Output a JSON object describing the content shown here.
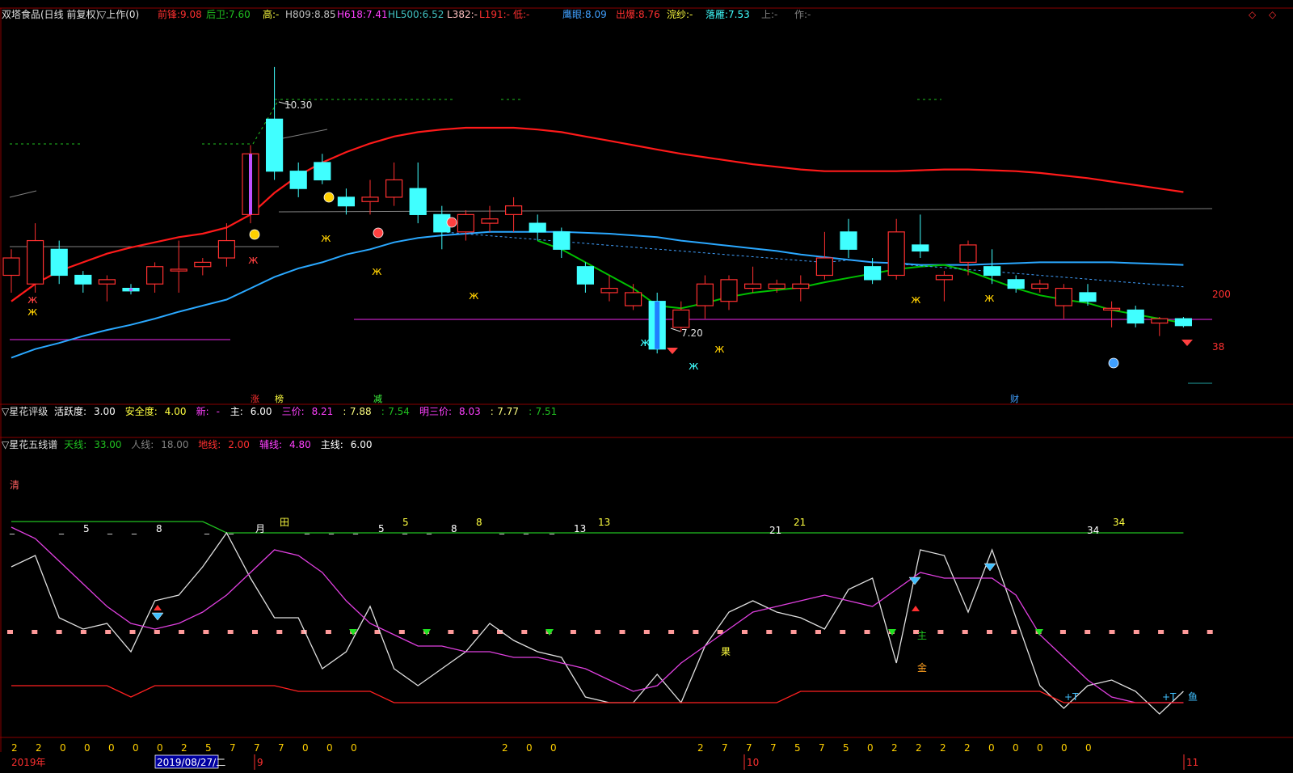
{
  "security": {
    "name": "双塔食品(日线 前复权)",
    "indicator": "▽上作(0)"
  },
  "header": {
    "indicators": [
      {
        "label": "前锋:",
        "value": "9.08",
        "color": "#ff3030"
      },
      {
        "label": "后卫:",
        "value": "7.60",
        "color": "#20c020"
      },
      {
        "label": "高:",
        "value": "-",
        "color": "#ffff40"
      },
      {
        "label": "H809:",
        "value": "8.85",
        "color": "#c0c0c0"
      },
      {
        "label": "H618:",
        "value": "7.41",
        "color": "#ff40ff"
      },
      {
        "label": "HL500:",
        "value": "6.52",
        "color": "#40c0c0"
      },
      {
        "label": "L382:",
        "value": "-",
        "color": "#ffc0c0"
      },
      {
        "label": "L191:",
        "value": "-",
        "color": "#ff3030"
      },
      {
        "label": "低:",
        "value": "-",
        "color": "#ff3030"
      },
      {
        "label": "鹰眼:",
        "value": "8.09",
        "color": "#40a0ff"
      },
      {
        "label": "出爆:",
        "value": "8.76",
        "color": "#ff3030"
      },
      {
        "label": "浣纱:",
        "value": "-",
        "color": "#ffff40"
      },
      {
        "label": "落雁:",
        "value": "7.53",
        "color": "#40ffff"
      },
      {
        "label": "上:",
        "value": "-",
        "color": "#808080"
      },
      {
        "label": "作:",
        "value": "-",
        "color": "#808080"
      }
    ]
  },
  "panel2": {
    "title": "▽星花评级",
    "items": [
      {
        "label": "活跃度:",
        "value": "3.00",
        "color": "#ffffff"
      },
      {
        "label": "安全度:",
        "value": "4.00",
        "color": "#ffff40"
      },
      {
        "label": "新:",
        "value": "-",
        "color": "#ff40ff"
      },
      {
        "label": "主:",
        "value": "6.00",
        "color": "#ffffff"
      },
      {
        "label": "三价:",
        "value": "8.21",
        "color": "#ff40ff"
      },
      {
        "label": ":",
        "value": "7.88",
        "color": "#ffff80"
      },
      {
        "label": ":",
        "value": "7.54",
        "color": "#20c020"
      },
      {
        "label": "明三价:",
        "value": "8.03",
        "color": "#ff40ff"
      },
      {
        "label": ":",
        "value": "7.77",
        "color": "#ffff80"
      },
      {
        "label": ":",
        "value": "7.51",
        "color": "#20c020"
      }
    ]
  },
  "panel3": {
    "title": "▽星花五线谱",
    "items": [
      {
        "label": "天线:",
        "value": "33.00",
        "color": "#20c020"
      },
      {
        "label": "人线:",
        "value": "18.00",
        "color": "#808080"
      },
      {
        "label": "地线:",
        "value": "2.00",
        "color": "#ff3030"
      },
      {
        "label": "辅线:",
        "value": "4.80",
        "color": "#ff40ff"
      },
      {
        "label": "主线:",
        "value": "6.00",
        "color": "#ffffff"
      }
    ]
  },
  "xaxis": {
    "year": "2019年",
    "cursor_date": "2019/08/27/二",
    "month_labels": [
      "9",
      "10",
      "11"
    ]
  },
  "chart_data": [
    {
      "type": "candlestick",
      "title": "双塔食品(日线 前复权)",
      "annotations": {
        "high": "10.30",
        "low": "7.20",
        "right_top": "200",
        "right_mid": "38"
      },
      "bottom_marks": [
        {
          "text": "涨",
          "color": "#ff3030"
        },
        {
          "text": "榜",
          "color": "#ffff40"
        },
        {
          "text": "减",
          "color": "#40ff40"
        },
        {
          "text": "财",
          "color": "#40a0ff"
        }
      ],
      "ylim": [
        6.6,
        10.7
      ],
      "candles": [
        {
          "o": 7.9,
          "c": 8.1,
          "h": 8.2,
          "l": 7.7
        },
        {
          "o": 7.8,
          "c": 8.3,
          "h": 8.5,
          "l": 7.7
        },
        {
          "o": 8.2,
          "c": 7.9,
          "h": 8.3,
          "l": 7.8
        },
        {
          "o": 7.9,
          "c": 7.8,
          "h": 7.95,
          "l": 7.7
        },
        {
          "o": 7.8,
          "c": 7.85,
          "h": 7.9,
          "l": 7.6
        },
        {
          "o": 7.75,
          "c": 7.72,
          "h": 7.8,
          "l": 7.68
        },
        {
          "o": 7.8,
          "c": 8.0,
          "h": 8.05,
          "l": 7.7
        },
        {
          "o": 7.95,
          "c": 7.97,
          "h": 8.3,
          "l": 7.7
        },
        {
          "o": 8.0,
          "c": 8.05,
          "h": 8.1,
          "l": 7.9
        },
        {
          "o": 8.1,
          "c": 8.3,
          "h": 8.5,
          "l": 8.0
        },
        {
          "o": 8.6,
          "c": 9.3,
          "h": 9.4,
          "l": 8.5
        },
        {
          "o": 9.7,
          "c": 9.1,
          "h": 10.3,
          "l": 9.0
        },
        {
          "o": 9.1,
          "c": 8.9,
          "h": 9.2,
          "l": 8.8
        },
        {
          "o": 9.2,
          "c": 9.0,
          "h": 9.3,
          "l": 8.95
        },
        {
          "o": 8.8,
          "c": 8.7,
          "h": 8.9,
          "l": 8.6
        },
        {
          "o": 8.75,
          "c": 8.8,
          "h": 9.0,
          "l": 8.6
        },
        {
          "o": 8.8,
          "c": 9.0,
          "h": 9.2,
          "l": 8.7
        },
        {
          "o": 8.9,
          "c": 8.6,
          "h": 9.2,
          "l": 8.5
        },
        {
          "o": 8.6,
          "c": 8.4,
          "h": 8.7,
          "l": 8.2
        },
        {
          "o": 8.4,
          "c": 8.6,
          "h": 8.65,
          "l": 8.3
        },
        {
          "o": 8.5,
          "c": 8.55,
          "h": 8.7,
          "l": 8.4
        },
        {
          "o": 8.6,
          "c": 8.7,
          "h": 8.8,
          "l": 8.4
        },
        {
          "o": 8.5,
          "c": 8.4,
          "h": 8.6,
          "l": 8.3
        },
        {
          "o": 8.4,
          "c": 8.2,
          "h": 8.45,
          "l": 8.1
        },
        {
          "o": 8.0,
          "c": 7.8,
          "h": 8.05,
          "l": 7.7
        },
        {
          "o": 7.7,
          "c": 7.75,
          "h": 7.9,
          "l": 7.6
        },
        {
          "o": 7.55,
          "c": 7.7,
          "h": 7.8,
          "l": 7.5
        },
        {
          "o": 7.6,
          "c": 7.05,
          "h": 7.7,
          "l": 7.0
        },
        {
          "o": 7.3,
          "c": 7.5,
          "h": 7.6,
          "l": 7.25
        },
        {
          "o": 7.55,
          "c": 7.8,
          "h": 7.9,
          "l": 7.4
        },
        {
          "o": 7.6,
          "c": 7.85,
          "h": 7.9,
          "l": 7.5
        },
        {
          "o": 7.75,
          "c": 7.8,
          "h": 8.0,
          "l": 7.7
        },
        {
          "o": 7.75,
          "c": 7.8,
          "h": 7.85,
          "l": 7.7
        },
        {
          "o": 7.75,
          "c": 7.8,
          "h": 7.9,
          "l": 7.6
        },
        {
          "o": 7.9,
          "c": 8.1,
          "h": 8.4,
          "l": 7.85
        },
        {
          "o": 8.4,
          "c": 8.2,
          "h": 8.55,
          "l": 8.1
        },
        {
          "o": 8.0,
          "c": 7.85,
          "h": 8.1,
          "l": 7.8
        },
        {
          "o": 7.9,
          "c": 8.4,
          "h": 8.55,
          "l": 7.85
        },
        {
          "o": 8.25,
          "c": 8.18,
          "h": 8.6,
          "l": 8.1
        },
        {
          "o": 7.85,
          "c": 7.9,
          "h": 7.95,
          "l": 7.6
        },
        {
          "o": 8.05,
          "c": 8.25,
          "h": 8.3,
          "l": 7.9
        },
        {
          "o": 8.0,
          "c": 7.9,
          "h": 8.2,
          "l": 7.8
        },
        {
          "o": 7.85,
          "c": 7.75,
          "h": 7.9,
          "l": 7.7
        },
        {
          "o": 7.75,
          "c": 7.8,
          "h": 7.85,
          "l": 7.7
        },
        {
          "o": 7.55,
          "c": 7.75,
          "h": 7.8,
          "l": 7.4
        },
        {
          "o": 7.7,
          "c": 7.6,
          "h": 7.8,
          "l": 7.55
        },
        {
          "o": 7.5,
          "c": 7.52,
          "h": 7.6,
          "l": 7.3
        },
        {
          "o": 7.5,
          "c": 7.35,
          "h": 7.55,
          "l": 7.3
        },
        {
          "o": 7.35,
          "c": 7.4,
          "h": 7.42,
          "l": 7.2
        },
        {
          "o": 7.4,
          "c": 7.32,
          "h": 7.42,
          "l": 7.3
        }
      ],
      "series": [
        {
          "color": "#ff1a1a",
          "values": [
            7.6,
            7.8,
            7.95,
            8.05,
            8.15,
            8.22,
            8.28,
            8.34,
            8.38,
            8.45,
            8.6,
            8.85,
            9.05,
            9.2,
            9.32,
            9.42,
            9.5,
            9.55,
            9.58,
            9.6,
            9.6,
            9.6,
            9.58,
            9.55,
            9.5,
            9.45,
            9.4,
            9.35,
            9.3,
            9.26,
            9.22,
            9.18,
            9.15,
            9.12,
            9.1,
            9.1,
            9.1,
            9.1,
            9.11,
            9.12,
            9.12,
            9.11,
            9.1,
            9.08,
            9.05,
            9.02,
            8.98,
            8.94,
            8.9,
            8.86
          ]
        },
        {
          "color": "#2aa8ff",
          "values": [
            6.95,
            7.05,
            7.12,
            7.2,
            7.27,
            7.33,
            7.4,
            7.48,
            7.55,
            7.62,
            7.75,
            7.88,
            7.98,
            8.05,
            8.14,
            8.2,
            8.28,
            8.33,
            8.36,
            8.38,
            8.4,
            8.4,
            8.4,
            8.4,
            8.39,
            8.38,
            8.36,
            8.34,
            8.3,
            8.27,
            8.24,
            8.21,
            8.18,
            8.14,
            8.11,
            8.08,
            8.05,
            8.04,
            8.02,
            8.02,
            8.02,
            8.03,
            8.04,
            8.05,
            8.05,
            8.05,
            8.05,
            8.04,
            8.03,
            8.02
          ]
        },
        {
          "color": "#00c000",
          "values": [
            null,
            null,
            null,
            null,
            null,
            null,
            null,
            null,
            null,
            null,
            null,
            null,
            null,
            null,
            null,
            null,
            null,
            null,
            null,
            null,
            null,
            null,
            8.3,
            8.2,
            8.05,
            7.9,
            7.75,
            7.55,
            7.52,
            7.58,
            7.65,
            7.7,
            7.73,
            7.76,
            7.82,
            7.87,
            7.92,
            7.97,
            8.0,
            8.02,
            7.95,
            7.85,
            7.75,
            7.67,
            7.62,
            7.58,
            7.5,
            7.45,
            7.4,
            7.35
          ]
        }
      ]
    },
    {
      "type": "line",
      "title": "▽星花五线谱",
      "ylim": [
        -5,
        45
      ],
      "x": [
        1,
        2,
        3,
        4,
        5,
        6,
        7,
        8,
        9,
        10,
        11,
        12,
        13,
        14,
        15,
        16,
        17,
        18,
        19,
        20,
        21,
        22,
        23,
        24,
        25,
        26,
        27,
        28,
        29,
        30,
        31,
        32,
        33,
        34,
        35,
        36,
        37,
        38,
        39,
        40,
        41,
        42,
        43,
        44,
        45,
        46,
        47,
        48,
        49,
        50
      ],
      "series": [
        {
          "name": "天线",
          "color": "#20c020",
          "values": [
            35,
            35,
            35,
            35,
            35,
            35,
            35,
            35,
            35,
            33,
            33,
            33,
            33,
            33,
            33,
            33,
            33,
            33,
            33,
            33,
            33,
            33,
            33,
            33,
            33,
            33,
            33,
            33,
            33,
            33,
            33,
            33,
            33,
            33,
            33,
            33,
            33,
            33,
            33,
            33,
            33,
            33,
            33,
            33,
            33,
            33,
            33,
            33,
            33,
            33
          ]
        },
        {
          "name": "主线",
          "color": "#e0e0e0",
          "values": [
            27,
            29,
            18,
            16,
            17,
            12,
            21,
            22,
            27,
            33,
            25,
            18,
            18,
            9,
            12,
            20,
            9,
            6,
            9,
            12,
            17,
            14,
            12,
            11,
            4,
            3,
            3,
            8,
            3,
            13,
            19,
            21,
            19,
            18,
            16,
            23,
            25,
            10,
            30,
            29,
            19,
            30,
            18,
            6,
            2,
            6,
            7,
            5,
            1,
            5
          ]
        },
        {
          "name": "辅线",
          "color": "#e040e0",
          "values": [
            34,
            32,
            28,
            24,
            20,
            17,
            16,
            17,
            19,
            22,
            26,
            30,
            29,
            26,
            21,
            17,
            15,
            13,
            13,
            12,
            12,
            11,
            11,
            10,
            9,
            7,
            5,
            6,
            10,
            13,
            16,
            19,
            20,
            21,
            22,
            21,
            20,
            23,
            26,
            25,
            25,
            25,
            22,
            15,
            11,
            7,
            4,
            3,
            3,
            3
          ]
        },
        {
          "name": "地线",
          "color": "#ff2020",
          "values": [
            6,
            6,
            6,
            6,
            6,
            4,
            6,
            6,
            6,
            6,
            6,
            6,
            5,
            5,
            5,
            5,
            3,
            3,
            3,
            3,
            3,
            3,
            3,
            3,
            3,
            3,
            3,
            3,
            3,
            3,
            3,
            3,
            3,
            5,
            5,
            5,
            5,
            5,
            5,
            5,
            5,
            5,
            5,
            5,
            3,
            3,
            3,
            3,
            3,
            3
          ]
        }
      ],
      "mid_level": 15.5,
      "labels": [
        {
          "text": "清",
          "color": "#ff6060"
        },
        {
          "text": "5",
          "color": "#ffffff"
        },
        {
          "text": "8",
          "color": "#ffffff"
        },
        {
          "text": "月",
          "color": "#ffffff"
        },
        {
          "text": "田",
          "color": "#ffff40"
        },
        {
          "text": "5",
          "color": "#ffffff"
        },
        {
          "text": "5",
          "color": "#ffff40"
        },
        {
          "text": "8",
          "color": "#ffffff"
        },
        {
          "text": "8",
          "color": "#ffff40"
        },
        {
          "text": "13",
          "color": "#ffffff"
        },
        {
          "text": "13",
          "color": "#ffff40"
        },
        {
          "text": "21",
          "color": "#ffffff"
        },
        {
          "text": "21",
          "color": "#ffff40"
        },
        {
          "text": "34",
          "color": "#ffffff"
        },
        {
          "text": "34",
          "color": "#ffff40"
        },
        {
          "text": "果",
          "color": "#ffff40"
        },
        {
          "text": "主",
          "color": "#20c020"
        },
        {
          "text": "金",
          "color": "#ffa020"
        },
        {
          "text": "+T",
          "color": "#40c0ff"
        },
        {
          "text": "+T",
          "color": "#40c0ff"
        },
        {
          "text": "鱼",
          "color": "#40c0ff"
        }
      ],
      "bottom_digits": [
        "2",
        "2",
        "0",
        "0",
        "0",
        "0",
        "0",
        "2",
        "5",
        "7",
        "7",
        "7",
        "0",
        "0",
        "0",
        "2",
        "0",
        "0",
        "2",
        "7",
        "7",
        "7",
        "5",
        "7",
        "5",
        "0",
        "2",
        "2",
        "2",
        "2",
        "0",
        "0",
        "0",
        "0",
        "0"
      ]
    }
  ]
}
